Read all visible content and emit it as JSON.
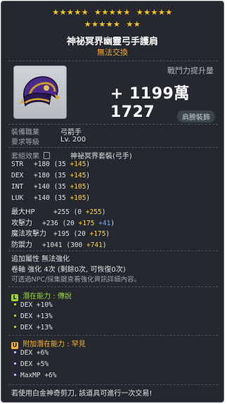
{
  "stars": {
    "filled": 22,
    "row1_groups": 5,
    "row2_groups": 2
  },
  "item": {
    "name": "神祕冥界幽靈弓手護肩",
    "trade_status": "無法交換",
    "combat_power_label": "戰鬥力提升量",
    "combat_power_value": "+ 1199萬 1727",
    "slot_badge": "肩膀裝飾",
    "icon": "shoulder-armor-icon"
  },
  "requirements": {
    "job_label": "裝備職業",
    "job_value": "弓箭手",
    "level_label": "要求等級",
    "level_value": "Lv. 200"
  },
  "set": {
    "label": "套組效果",
    "icon": "lock-icon",
    "value": "神祕冥界套裝(弓手)"
  },
  "stats": [
    {
      "name": "STR",
      "total": "+180",
      "open": "(35",
      "bonus": "+145",
      "close": ")"
    },
    {
      "name": "DEX",
      "total": "+180",
      "open": "(35",
      "bonus": "+145",
      "close": ")"
    },
    {
      "name": "INT",
      "total": "+140",
      "open": "(35",
      "bonus": "+105",
      "close": ")"
    },
    {
      "name": "LUK",
      "total": "+140",
      "open": "(35",
      "bonus": "+105",
      "close": ")"
    },
    {
      "name": "最大HP",
      "total": "+255",
      "open": "(0",
      "bonus": "+255",
      "close": ")"
    },
    {
      "name": "攻擊力",
      "total": "+236",
      "open": "(20",
      "bonus": "+175",
      "bonus2": "+41",
      "close": ")"
    },
    {
      "name": "魔法攻擊力",
      "total": "+195",
      "open": "(20",
      "bonus": "+175",
      "close": ")"
    },
    {
      "name": "防禦力",
      "total": "+1041",
      "open": "(300",
      "bonus": "+741",
      "close": ")"
    }
  ],
  "extra": {
    "line1": "追加屬性 無法強化",
    "line2": "卷軸 強化 4次 (剩餘0次, 可恢復0次)",
    "line3": "可透過NPC/採集鍵查看強化資訊詳細內容。"
  },
  "potential": {
    "label": "潛在能力 : 傳說",
    "badge": "L",
    "color": "#9bd23b",
    "lines": [
      "DEX +10%",
      "DEX +13%",
      "DEX +13%"
    ]
  },
  "additional_potential": {
    "label": "附加潛在能力 : 罕見",
    "badge": "U",
    "color": "#f0b23a",
    "lines": [
      "DEX +6%",
      "DEX +5%",
      "MaxMP +6%"
    ]
  },
  "footer": "若使用白金神奇剪刀, 該道具可進行一次交易!"
}
